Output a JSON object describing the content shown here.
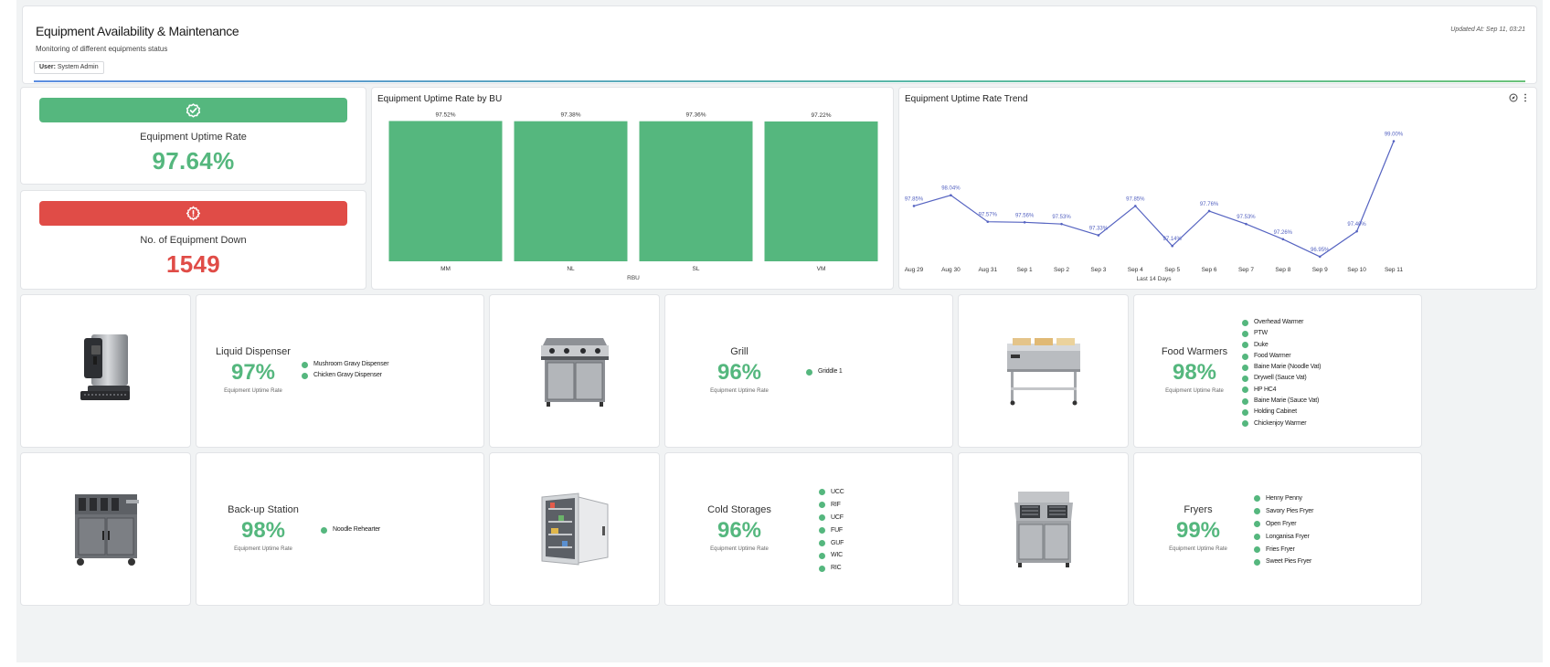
{
  "header": {
    "title": "Equipment Availability & Maintenance",
    "subtitle": "Monitoring of different equipments status",
    "user_label": "User:",
    "user_name": "System Admin",
    "updated": "Updated At: Sep 11, 03:21"
  },
  "kpis": {
    "uptime": {
      "label": "Equipment Uptime Rate",
      "value": "97.64%",
      "icon": "check-badge-icon",
      "color": "#55b77e"
    },
    "down": {
      "label": "No. of Equipment Down",
      "value": "1549",
      "icon": "gear-warning-icon",
      "color": "#e04c47"
    }
  },
  "bar_chart": {
    "title": "Equipment Uptime Rate by BU",
    "color": "#55b77e",
    "chart_data": {
      "type": "bar",
      "title": "Equipment Uptime Rate by BU",
      "xlabel": "RBU",
      "ylabel": "",
      "categories": [
        "MM",
        "NL",
        "SL",
        "VM"
      ],
      "values": [
        97.52,
        97.38,
        97.36,
        97.22
      ],
      "labels": [
        "97.52%",
        "97.38%",
        "97.36%",
        "97.22%"
      ],
      "grid": false
    }
  },
  "line_chart": {
    "title": "Equipment Uptime Rate Trend",
    "color": "#5563c1",
    "chart_data": {
      "type": "line",
      "title": "Equipment Uptime Rate Trend",
      "xlabel": "Last 14 Days",
      "ylabel": "",
      "categories": [
        "Aug 29",
        "Aug 30",
        "Aug 31",
        "Sep 1",
        "Sep 2",
        "Sep 3",
        "Sep 4",
        "Sep 5",
        "Sep 6",
        "Sep 7",
        "Sep 8",
        "Sep 9",
        "Sep 10",
        "Sep 11"
      ],
      "values": [
        97.85,
        98.04,
        97.57,
        97.56,
        97.53,
        97.33,
        97.85,
        97.14,
        97.76,
        97.53,
        97.26,
        96.95,
        97.4,
        99.0
      ],
      "labels": [
        "97.85%",
        "98.04%",
        "97.57%",
        "97.56%",
        "97.53%",
        "97.33%",
        "97.85%",
        "97.14%",
        "97.76%",
        "97.53%",
        "97.26%",
        "96.95%",
        "97.40%",
        "99.00%"
      ],
      "ylim": [
        96.9,
        99.3
      ],
      "grid": false
    }
  },
  "equipment": [
    {
      "name": "Liquid Dispenser",
      "pct": "97%",
      "sub": "Equipment Uptime Rate",
      "image": "liquid-dispenser-image",
      "items": [
        "Mushroom Gravy Dispenser",
        "Chicken Gravy Dispenser"
      ]
    },
    {
      "name": "Grill",
      "pct": "96%",
      "sub": "Equipment Uptime Rate",
      "image": "griddle-image",
      "items": [
        "Griddle 1"
      ]
    },
    {
      "name": "Food Warmers",
      "pct": "98%",
      "sub": "Equipment Uptime Rate",
      "image": "food-warmer-image",
      "items": [
        "Overhead Warmer",
        "PTW",
        "Duke",
        "Food Warmer",
        "Baine Marie (Noodle Vat)",
        "Drywell (Sauce Vat)",
        "HP HC4",
        "Baine Marie (Sauce Vat)",
        "Holding Cabinet",
        "Chickenjoy Warmer"
      ]
    },
    {
      "name": "Back-up Station",
      "pct": "98%",
      "sub": "Equipment Uptime Rate",
      "image": "backup-station-image",
      "items": [
        "Noodle Rehearter"
      ]
    },
    {
      "name": "Cold Storages",
      "pct": "96%",
      "sub": "Equipment Uptime Rate",
      "image": "walk-in-freezer-image",
      "items": [
        "UCC",
        "RIF",
        "UCF",
        "FUF",
        "GUF",
        "WIC",
        "RIC"
      ]
    },
    {
      "name": "Fryers",
      "pct": "99%",
      "sub": "Equipment Uptime Rate",
      "image": "fryer-image",
      "items": [
        "Henny Penny",
        "Savory Pies Fryer",
        "Open Fryer",
        "Longanisa Fryer",
        "Fries Fryer",
        "Sweet Pies Fryer"
      ]
    }
  ]
}
